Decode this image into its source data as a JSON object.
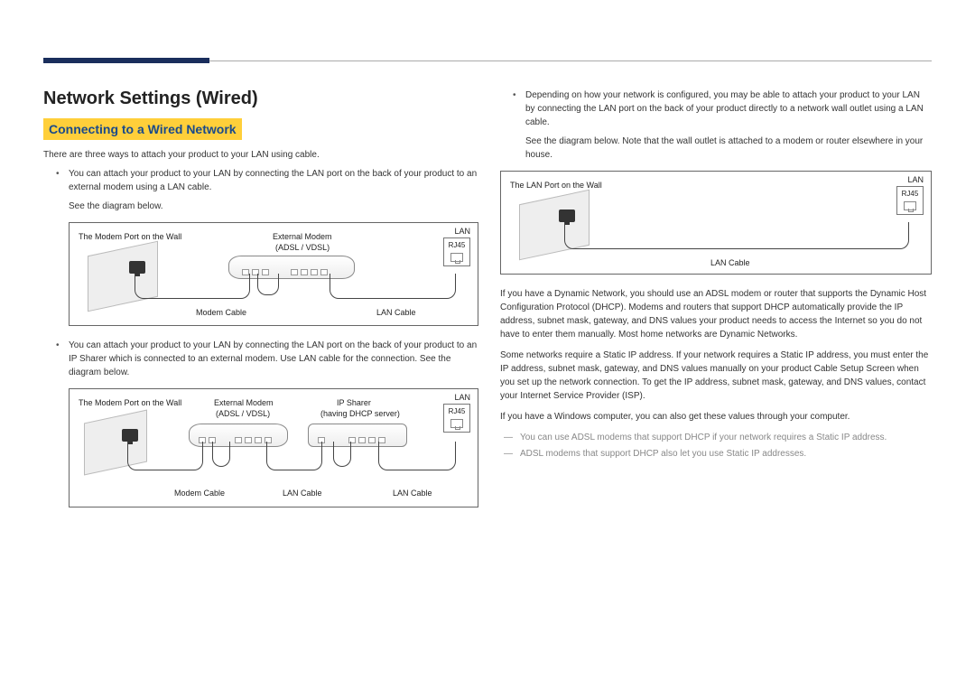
{
  "header": {
    "title": "Network Settings (Wired)",
    "subtitle": "Connecting to a Wired Network"
  },
  "left": {
    "intro": "There are three ways to attach your product to your LAN using cable.",
    "bullet1": "You can attach your product to your LAN by connecting the LAN port on the back of your product to an external modem using a LAN cable.",
    "bullet1_sub": "See the diagram below.",
    "bullet2": "You can attach your product to your LAN by connecting the LAN port on the back of your product to an IP Sharer which is connected to an external modem. Use LAN cable for the connection. See the diagram below."
  },
  "right": {
    "bullet3": "Depending on how your network is configured, you may be able to attach your product to your LAN by connecting the LAN port on the back of your product directly to a network wall outlet using a LAN cable.",
    "bullet3_sub": "See the diagram below. Note that the wall outlet is attached to a modem or router elsewhere in your house.",
    "para1": "If you have a Dynamic Network, you should use an ADSL modem or router that supports the Dynamic Host Configuration Protocol (DHCP). Modems and routers that support DHCP automatically provide the IP address, subnet mask, gateway, and DNS values your product needs to access the Internet so you do not have to enter them manually. Most home networks are Dynamic Networks.",
    "para2": "Some networks require a Static IP address. If your network requires a Static IP address, you must enter the IP address, subnet mask, gateway, and DNS values manually on your product Cable Setup Screen when you set up the network connection. To get the IP address, subnet mask, gateway, and DNS values, contact your Internet Service Provider (ISP).",
    "para3": "If you have a Windows computer, you can also get these values through your computer.",
    "note1": "You can use ADSL modems that support DHCP if your network requires a Static IP address.",
    "note2": "ADSL modems that support DHCP also let you use Static IP addresses."
  },
  "diagrams": {
    "d1": {
      "wall_label": "The Modem Port on the Wall",
      "modem_label1": "External Modem",
      "modem_label2": "(ADSL / VDSL)",
      "lan": "LAN",
      "rj45": "RJ45",
      "cable_left": "Modem Cable",
      "cable_right": "LAN Cable"
    },
    "d2": {
      "wall_label": "The Modem Port on the Wall",
      "modem_label1": "External Modem",
      "modem_label2": "(ADSL / VDSL)",
      "sharer_label1": "IP Sharer",
      "sharer_label2": "(having DHCP server)",
      "lan": "LAN",
      "rj45": "RJ45",
      "cable_left": "Modem Cable",
      "cable_mid": "LAN Cable",
      "cable_right": "LAN Cable"
    },
    "d3": {
      "wall_label": "The LAN Port on the Wall",
      "lan": "LAN",
      "rj45": "RJ45",
      "cable": "LAN Cable"
    }
  }
}
